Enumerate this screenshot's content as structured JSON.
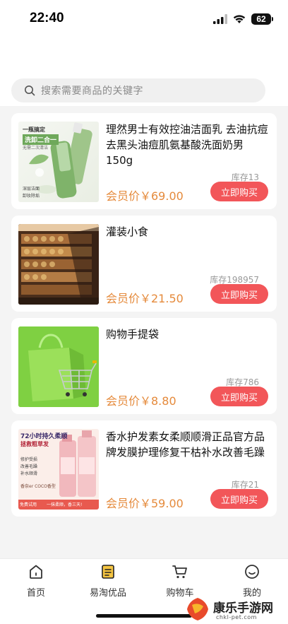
{
  "status": {
    "time": "22:40",
    "battery": "62"
  },
  "search": {
    "placeholder": "搜索需要商品的关键字"
  },
  "products": [
    {
      "title": "理然男士有效控油洁面乳 去油抗痘去黑头油痘肌氨基酸洗面奶男150g",
      "stock": "库存13",
      "price": "会员价￥69.00",
      "buy": "立即购买",
      "image_text": {
        "line1": "一瓶搞定",
        "line2": "洗卸二合一",
        "line3": "无需二次清洁",
        "tag1": "深层洁面",
        "tag2": "卸妆除垢"
      }
    },
    {
      "title": "灌装小食",
      "stock": "库存198957",
      "price": "会员价￥21.50",
      "buy": "立即购买"
    },
    {
      "title": "购物手提袋",
      "stock": "库存786",
      "price": "会员价￥8.80",
      "buy": "立即购买"
    },
    {
      "title": "香水护发素女柔顺顺滑正品官方品牌发膜护理修复干枯补水改善毛躁",
      "stock": "库存21",
      "price": "会员价￥59.00",
      "buy": "立即购买",
      "image_text": {
        "headline": "72小时持久柔顺",
        "sub": "拯救粗草发",
        "tag1": "修护受损",
        "tag2": "改善毛躁",
        "tag3": "补水顺滑",
        "brand": "香奈er COCO香型",
        "bottom_left": "免费试用",
        "bottom_right": "一抹柔顺，香三天!"
      }
    }
  ],
  "tabs": [
    {
      "label": "首页",
      "icon": "home-icon"
    },
    {
      "label": "易淘优品",
      "icon": "list-icon"
    },
    {
      "label": "购物车",
      "icon": "cart-icon"
    },
    {
      "label": "我的",
      "icon": "user-icon"
    }
  ],
  "watermark": {
    "title": "康乐手游网",
    "sub": "chkl-pet.com"
  },
  "colors": {
    "buy_button": "#f25659",
    "price": "#e58a3b",
    "active_tab_icon": "#f5c542"
  }
}
